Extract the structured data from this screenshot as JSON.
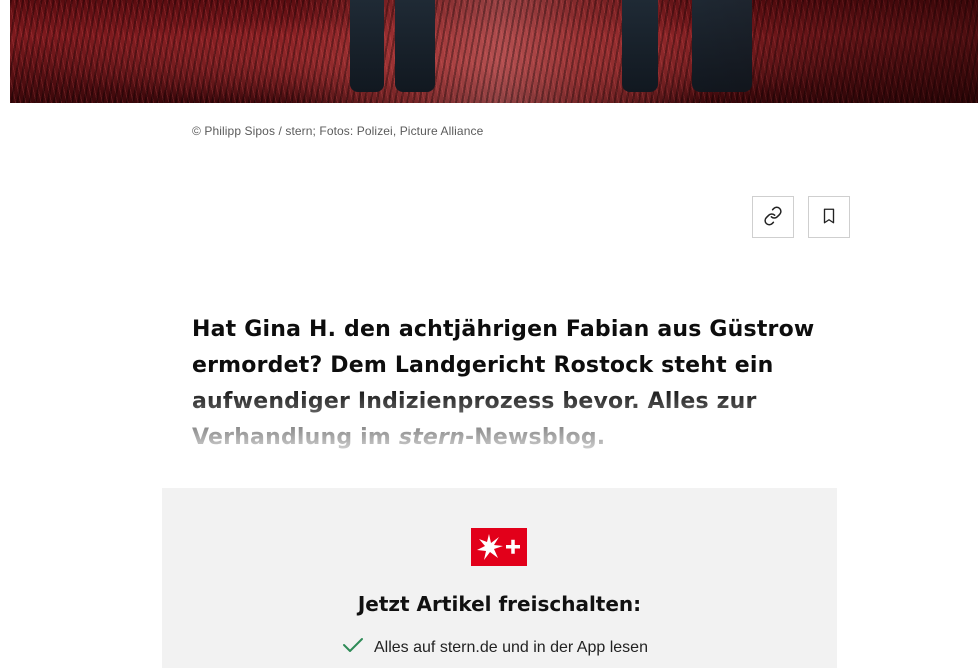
{
  "hero": {
    "alt": "Hero image"
  },
  "caption": "© Philipp Sipos / stern; Fotos: Polizei, Picture Alliance",
  "actions": {
    "share_icon": "link-icon",
    "bookmark_icon": "bookmark-icon"
  },
  "teaser": {
    "part1": "Hat Gina H. den achtjährigen Fabian aus Güstrow ermordet? Dem Landgericht Rostock steht ein aufwendiger Indizienprozess bevor. Alles zur Verhandlung im ",
    "italic": "stern",
    "part2": "-Newsblog."
  },
  "paywall": {
    "logo": "stern-plus-logo",
    "title": "Jetzt Artikel freischalten:",
    "benefits": [
      "Alles auf stern.de und in der App lesen"
    ]
  },
  "colors": {
    "brand_red": "#e2001a",
    "check_green": "#2e8b57"
  }
}
